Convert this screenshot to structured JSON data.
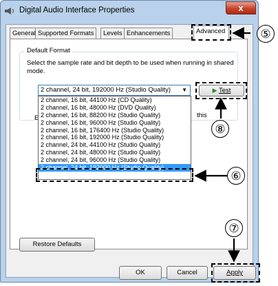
{
  "window": {
    "title": "Digital Audio Interface Properties",
    "close_label": "x"
  },
  "tabs": [
    {
      "label": "General"
    },
    {
      "label": "Supported Formats"
    },
    {
      "label": "Levels"
    },
    {
      "label": "Enhancements"
    },
    {
      "label": "Advanced"
    }
  ],
  "default_format": {
    "legend": "Default Format",
    "description": "Select the sample rate and bit depth to be used when running in shared mode.",
    "selected": "2 channel, 24 bit, 192000 Hz (Studio Quality)",
    "test_label": "Test",
    "options": [
      "2 channel, 16 bit, 44100 Hz (CD Quality)",
      "2 channel, 16 bit, 48000 Hz (DVD Quality)",
      "2 channel, 16 bit, 88200 Hz (Studio Quality)",
      "2 channel, 16 bit, 96000 Hz (Studio Quality)",
      "2 channel, 16 bit, 176400 Hz (Studio Quality)",
      "2 channel, 16 bit, 192000 Hz (Studio Quality)",
      "2 channel, 24 bit, 44100 Hz (Studio Quality)",
      "2 channel, 24 bit, 48000 Hz (Studio Quality)",
      "2 channel, 24 bit, 96000 Hz (Studio Quality)",
      "2 channel, 24 bit, 192000 Hz (Studio Quality)"
    ],
    "selected_index": 9
  },
  "obscured": {
    "letter": "E",
    "fragment": "this"
  },
  "buttons": {
    "restore": "Restore Defaults",
    "ok": "OK",
    "cancel": "Cancel",
    "apply": "Apply"
  },
  "callouts": {
    "c5": "⑤",
    "c6": "⑥",
    "c7": "⑦",
    "c8": "⑧"
  },
  "colors": {
    "selection": "#3399ff",
    "window_frame": "#b9d1ea",
    "close_button": "#c7432b"
  }
}
